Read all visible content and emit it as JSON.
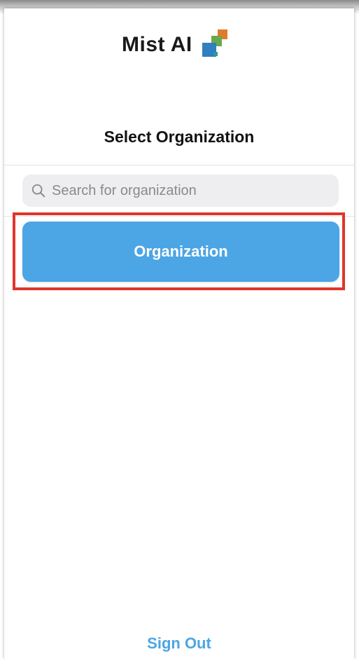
{
  "logo": {
    "text": "Mist AI",
    "colors": [
      "#e07b2a",
      "#6aa84f",
      "#2f7fc1",
      "#2a9d8f"
    ]
  },
  "page": {
    "title": "Select Organization"
  },
  "search": {
    "placeholder": "Search for organization",
    "value": ""
  },
  "organizations": [
    {
      "label": "Organization"
    }
  ],
  "footer": {
    "sign_out_label": "Sign Out"
  },
  "colors": {
    "accent": "#4ca5e4",
    "highlight_border": "#e0362c",
    "search_bg": "#eeeef0"
  },
  "icons": {
    "search": "magnifier"
  }
}
